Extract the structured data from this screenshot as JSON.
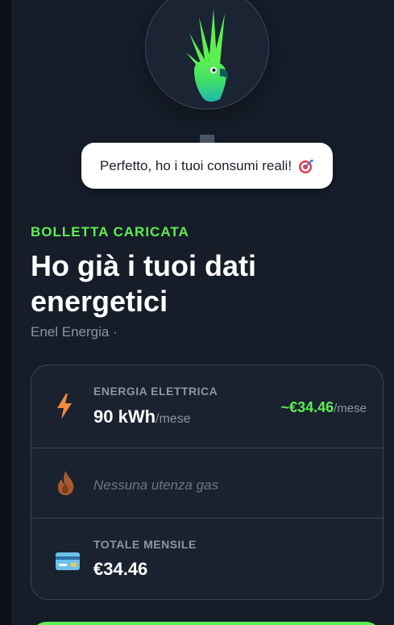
{
  "assistant": {
    "mascot_icon": "cockatoo-mascot-icon",
    "message": "Perfetto, ho i tuoi consumi reali!",
    "message_icon": "target-icon"
  },
  "section": {
    "kicker": "BOLLETTA CARICATA",
    "headline": "Ho già i tuoi dati energetici",
    "provider": "Enel Energia ·"
  },
  "summary": {
    "electricity": {
      "icon": "lightning-icon",
      "label": "ENERGIA ELETTRICA",
      "value": "90 kWh",
      "unit": "/mese",
      "price": "~€34.46",
      "price_unit": "/mese"
    },
    "gas": {
      "icon": "flame-icon",
      "text": "Nessuna utenza gas"
    },
    "total": {
      "icon": "credit-card-icon",
      "label": "TOTALE MENSILE",
      "value": "€34.46"
    }
  },
  "colors": {
    "accent": "#5cf04f",
    "background": "#161d29",
    "card": "#1a2230",
    "muted": "#8a95a5"
  }
}
